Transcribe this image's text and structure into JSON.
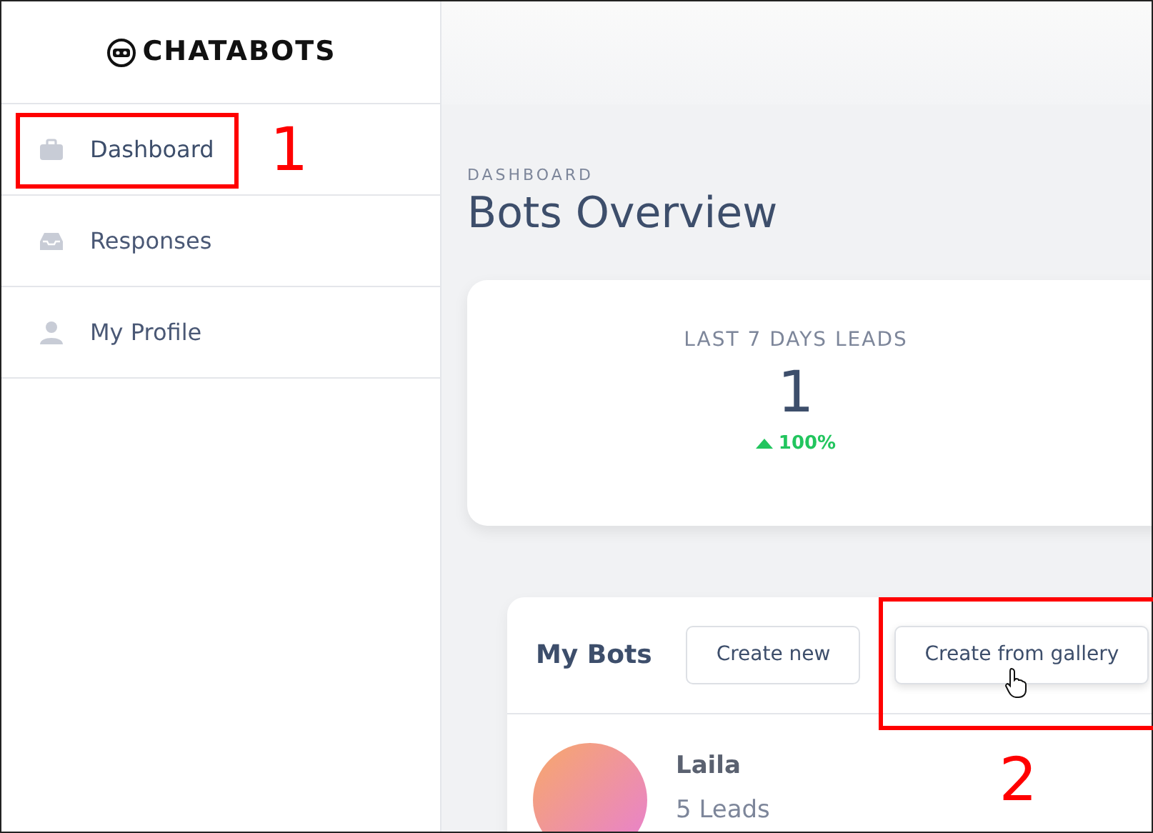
{
  "brand": {
    "name": "CHATABOTS"
  },
  "sidebar": {
    "items": [
      {
        "label": "Dashboard",
        "selected": true
      },
      {
        "label": "Responses",
        "selected": false
      },
      {
        "label": "My Profile",
        "selected": false
      }
    ]
  },
  "page": {
    "eyebrow": "DASHBOARD",
    "title": "Bots Overview"
  },
  "stat": {
    "label": "LAST 7 DAYS LEADS",
    "value": "1",
    "change": "100%"
  },
  "bots_panel": {
    "title": "My Bots",
    "buttons": [
      {
        "label": "Create new",
        "hovered": false
      },
      {
        "label": "Create from gallery",
        "hovered": true
      }
    ],
    "bots": [
      {
        "name": "Laila",
        "leads": "5 Leads"
      }
    ]
  },
  "annotations": [
    {
      "label": "1"
    },
    {
      "label": "2"
    }
  ]
}
